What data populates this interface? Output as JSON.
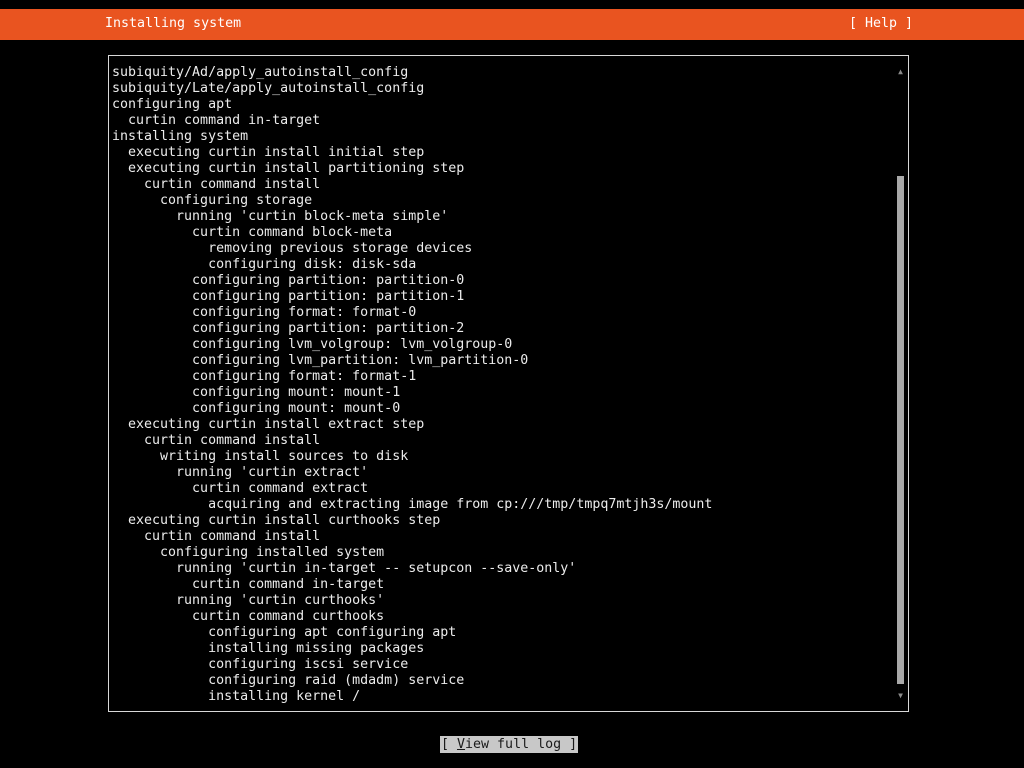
{
  "header": {
    "title": "Installing system",
    "help_label": "[ Help ]",
    "accent_color": "#e95420"
  },
  "log": {
    "lines": [
      "subiquity/Ad/apply_autoinstall_config",
      "subiquity/Late/apply_autoinstall_config",
      "configuring apt",
      "  curtin command in-target",
      "installing system",
      "  executing curtin install initial step",
      "  executing curtin install partitioning step",
      "    curtin command install",
      "      configuring storage",
      "        running 'curtin block-meta simple'",
      "          curtin command block-meta",
      "            removing previous storage devices",
      "            configuring disk: disk-sda",
      "          configuring partition: partition-0",
      "          configuring partition: partition-1",
      "          configuring format: format-0",
      "          configuring partition: partition-2",
      "          configuring lvm_volgroup: lvm_volgroup-0",
      "          configuring lvm_partition: lvm_partition-0",
      "          configuring format: format-1",
      "          configuring mount: mount-1",
      "          configuring mount: mount-0",
      "  executing curtin install extract step",
      "    curtin command install",
      "      writing install sources to disk",
      "        running 'curtin extract'",
      "          curtin command extract",
      "            acquiring and extracting image from cp:///tmp/tmpq7mtjh3s/mount",
      "  executing curtin install curthooks step",
      "    curtin command install",
      "      configuring installed system",
      "        running 'curtin in-target -- setupcon --save-only'",
      "          curtin command in-target",
      "        running 'curtin curthooks'",
      "          curtin command curthooks",
      "            configuring apt configuring apt",
      "            installing missing packages",
      "            configuring iscsi service",
      "            configuring raid (mdadm) service",
      "            installing kernel /"
    ]
  },
  "footer": {
    "view_log": {
      "open": "[ ",
      "hotkey": "V",
      "rest": "iew full log ]"
    }
  }
}
